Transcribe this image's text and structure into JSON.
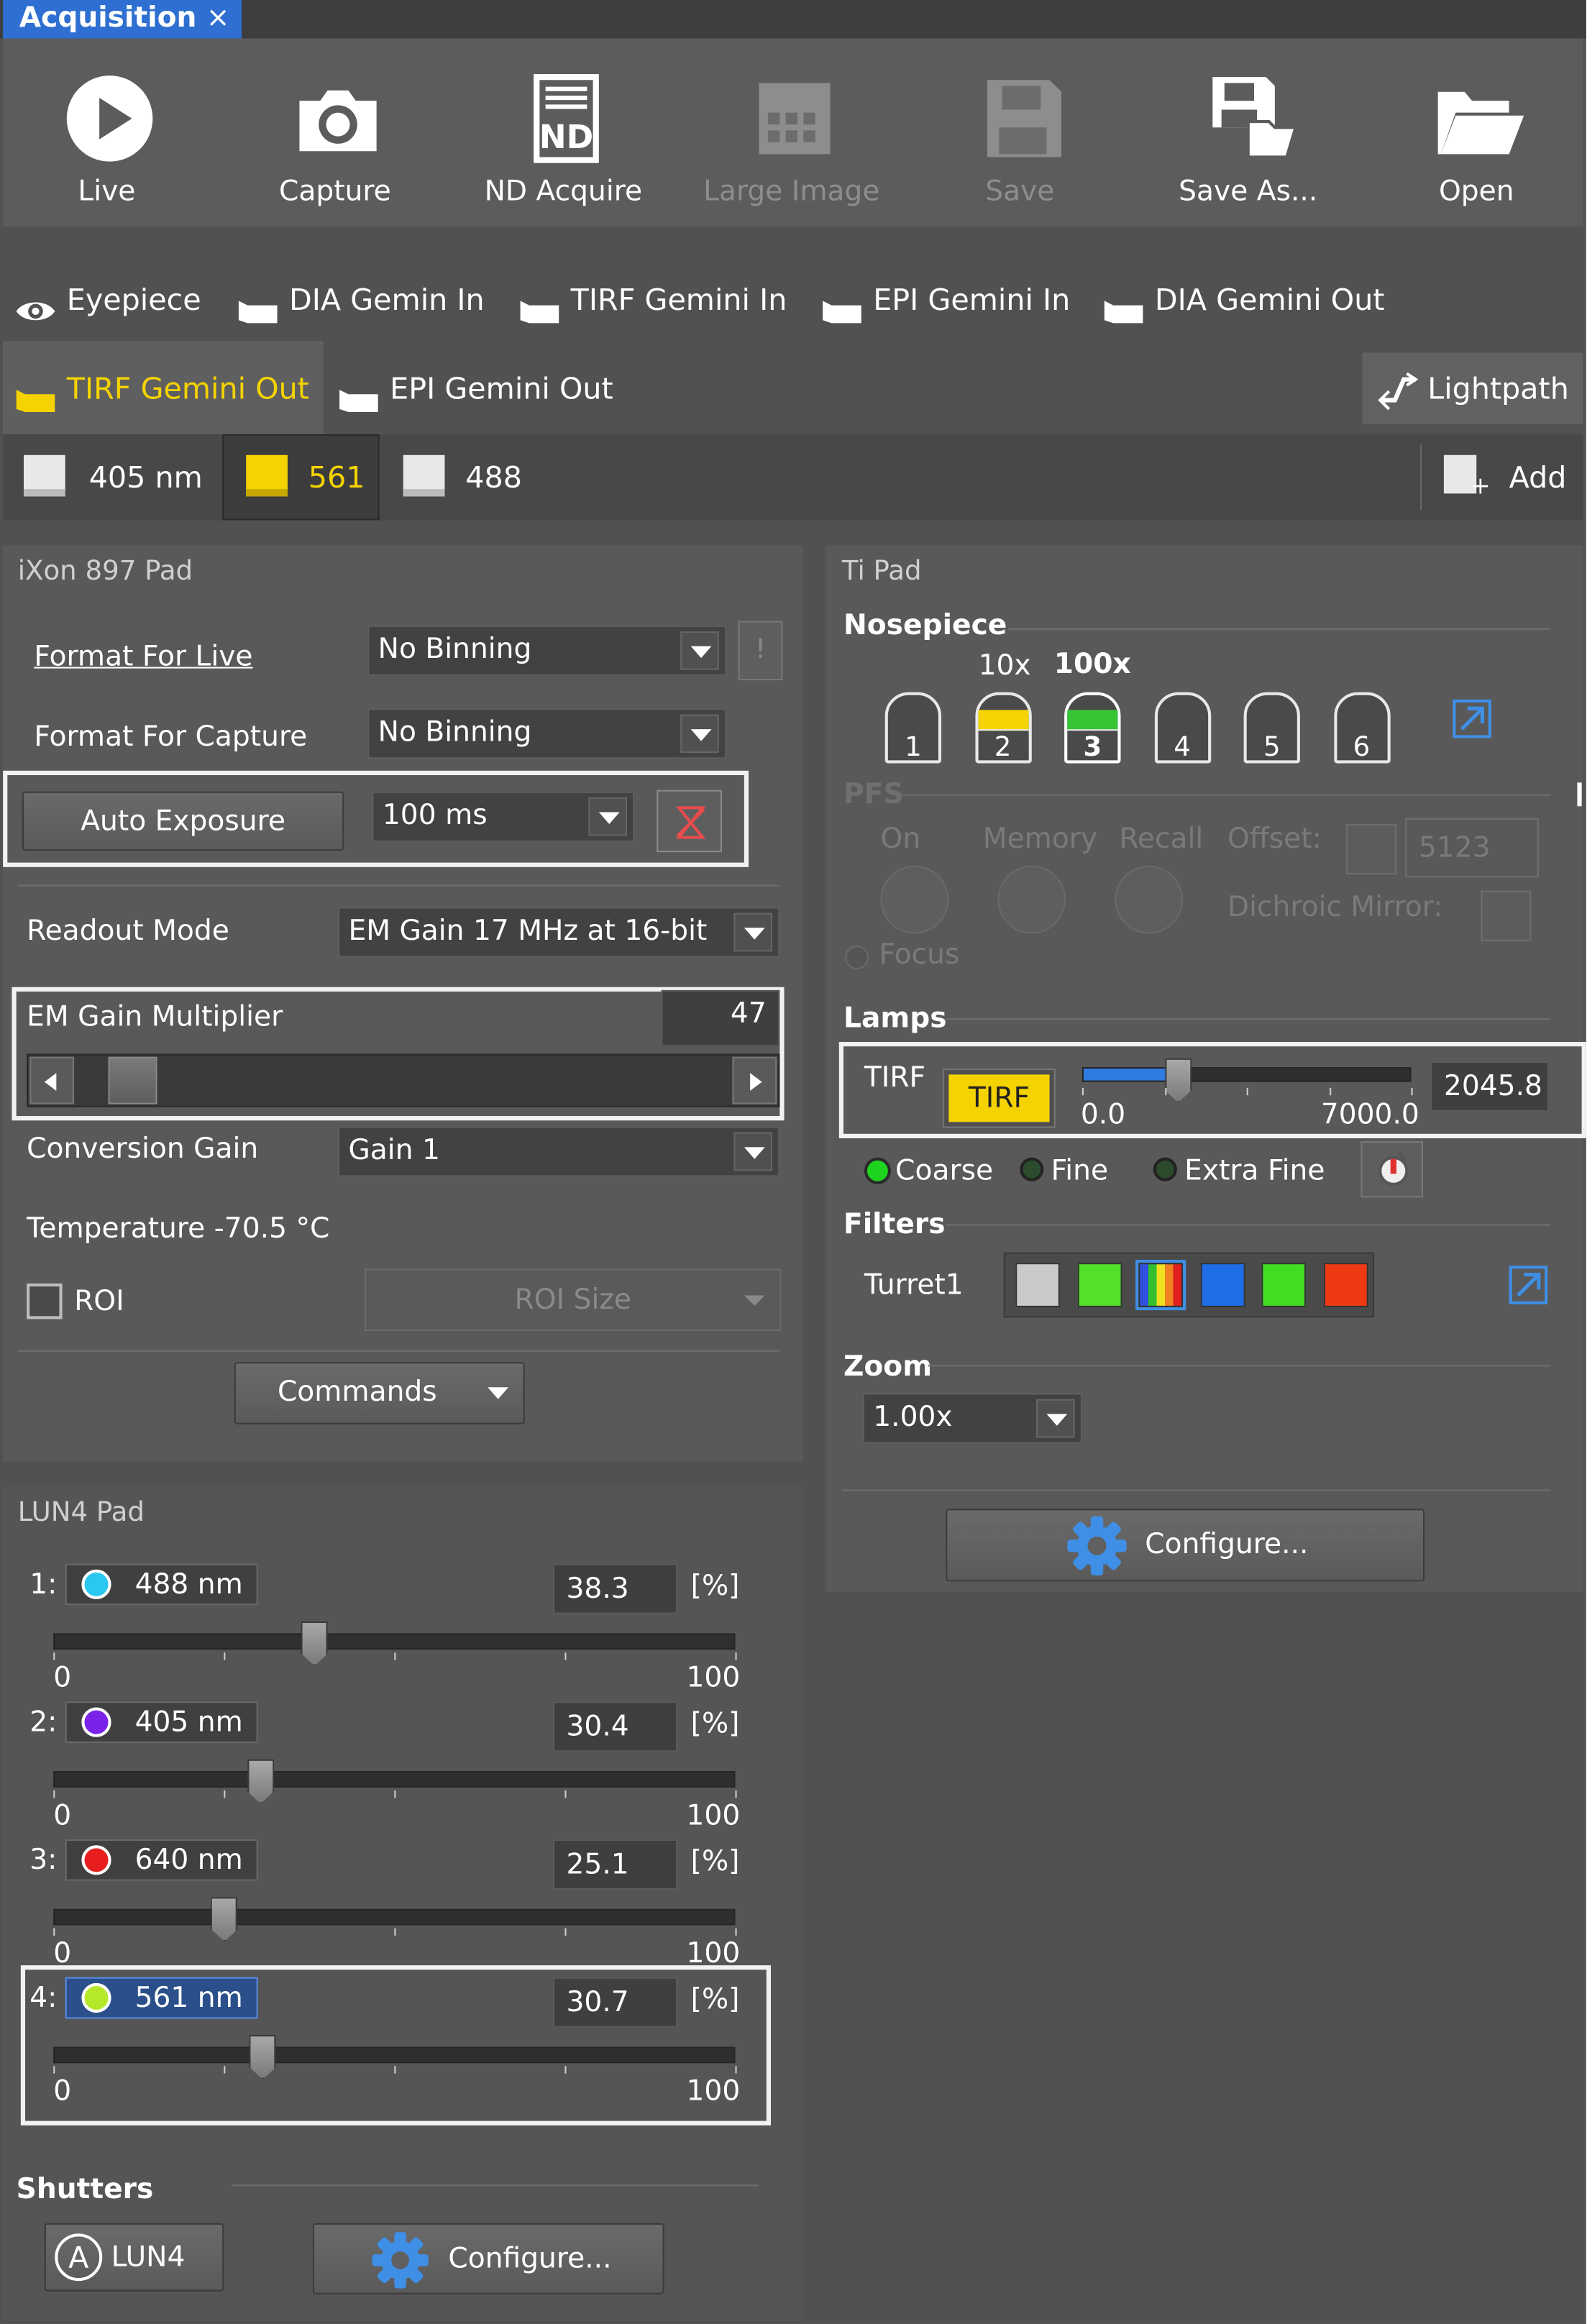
{
  "tab": {
    "title": "Acquisition",
    "close": "×"
  },
  "toolbar": {
    "live": "Live",
    "capture": "Capture",
    "nd_acquire": "ND Acquire",
    "large_image": "Large Image",
    "save": "Save",
    "save_as": "Save As...",
    "open": "Open"
  },
  "lightpath": {
    "row1": [
      "Eyepiece",
      "DIA Gemin In",
      "TIRF Gemini In",
      "EPI Gemini In",
      "DIA Gemini Out"
    ],
    "active": "TIRF Gemini Out",
    "epi_out": "EPI Gemini Out",
    "lightpath_btn": "Lightpath"
  },
  "channels": {
    "c1": "405 nm",
    "c2": "561",
    "c3": "488",
    "add": "Add"
  },
  "ixon": {
    "title": "iXon 897 Pad",
    "format_live_label": "Format For Live",
    "format_live": "No Binning",
    "format_capture_label": "Format For Capture",
    "format_capture": "No Binning",
    "auto_exposure": "Auto Exposure",
    "exposure": "100 ms",
    "readout_label": "Readout Mode",
    "readout": "EM Gain 17 MHz at 16-bit",
    "em_label": "EM Gain Multiplier",
    "em_value": "47",
    "conv_label": "Conversion Gain",
    "conv": "Gain 1",
    "temperature": "Temperature -70.5 °C",
    "roi": "ROI",
    "roi_size": "ROI Size",
    "commands": "Commands"
  },
  "lun4": {
    "title": "LUN4 Pad",
    "lines": [
      {
        "idx": "1:",
        "name": "488 nm",
        "value": "38.3",
        "unit": "[%]",
        "color": "#29c8f0",
        "min": "0",
        "max": "100",
        "fraction": 0.383
      },
      {
        "idx": "2:",
        "name": "405 nm",
        "value": "30.4",
        "unit": "[%]",
        "color": "#7a22e8",
        "min": "0",
        "max": "100",
        "fraction": 0.304
      },
      {
        "idx": "3:",
        "name": "640 nm",
        "value": "25.1",
        "unit": "[%]",
        "color": "#e81e1e",
        "min": "0",
        "max": "100",
        "fraction": 0.251
      },
      {
        "idx": "4:",
        "name": "561 nm",
        "value": "30.7",
        "unit": "[%]",
        "color": "#b6e82a",
        "min": "0",
        "max": "100",
        "fraction": 0.307
      }
    ]
  },
  "shutters": {
    "title": "Shutters",
    "lun4": "LUN4",
    "configure": "Configure..."
  },
  "tipad": {
    "title": "Ti Pad",
    "nosepiece": "Nosepiece",
    "mag10": "10x",
    "mag100": "100x",
    "objectives": [
      "1",
      "2",
      "3",
      "4",
      "5",
      "6"
    ],
    "pfs": "PFS",
    "on": "On",
    "memory": "Memory",
    "recall": "Recall",
    "offset_label": "Offset:",
    "offset": "5123",
    "dichroic": "Dichroic Mirror:",
    "focus": "Focus",
    "lamps": "Lamps",
    "tirf_label": "TIRF",
    "tirf_btn": "TIRF",
    "lamp_min": "0.0",
    "lamp_max": "7000.0",
    "lamp_value": "2045.8",
    "lamp_fraction": 0.292,
    "coarse": "Coarse",
    "fine": "Fine",
    "extra_fine": "Extra Fine",
    "filters": "Filters",
    "turret": "Turret1",
    "filter_colors": [
      "#c9c9c9",
      "#52e02a",
      "spectrum",
      "#1f6ee8",
      "#42dd22",
      "#ee3a14"
    ],
    "zoom": "Zoom",
    "zoom_value": "1.00x",
    "configure": "Configure..."
  }
}
